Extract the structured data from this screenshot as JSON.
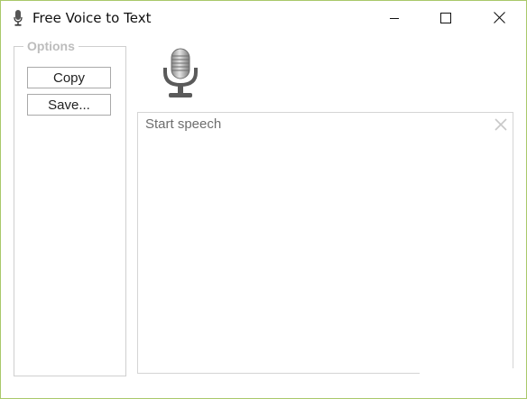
{
  "window": {
    "title": "Free Voice to Text",
    "accent_border": "#a9c96a"
  },
  "icons": {
    "app": "microphone-icon",
    "minimize": "minimize-icon",
    "maximize": "maximize-icon",
    "close": "close-icon",
    "mic": "microphone-icon",
    "clear": "clear-icon"
  },
  "options": {
    "legend": "Options",
    "copy_label": "Copy",
    "save_label": "Save..."
  },
  "speech": {
    "placeholder": "Start speech"
  }
}
